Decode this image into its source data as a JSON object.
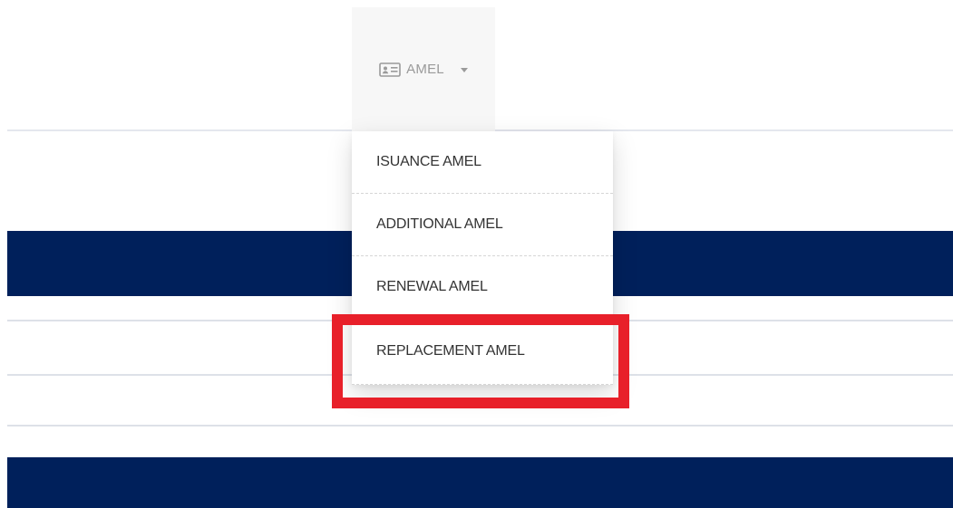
{
  "nav": {
    "label": "AMEL",
    "icon": "id-card-icon",
    "caret_icon": "caret-down-icon"
  },
  "dropdown": {
    "items": [
      {
        "label": "ISUANCE AMEL"
      },
      {
        "label": "ADDITIONAL AMEL"
      },
      {
        "label": "RENEWAL AMEL"
      },
      {
        "label": "REPLACEMENT AMEL"
      }
    ],
    "highlighted_item": "REPLACEMENT AMEL"
  },
  "colors": {
    "navy": "#00205b",
    "highlight_red": "#e8202a",
    "trigger_bg": "#f7f7f7",
    "muted_text": "#9a9a9a"
  }
}
